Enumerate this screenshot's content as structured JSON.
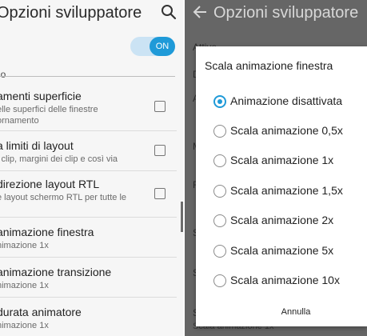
{
  "left": {
    "title": "Opzioni sviluppatore",
    "toggle_label": "ON",
    "section_header": "ho",
    "items": [
      {
        "title": "amenti superficie",
        "sub1": "elle superfici delle finestre",
        "sub2": "ornamento",
        "checkbox": true
      },
      {
        "title": "a limiti di layout",
        "sub1": "i clip, margini dei clip e così via",
        "sub2": "",
        "checkbox": true
      },
      {
        "title": "direzione layout RTL",
        "sub1": "e layout schermo RTL per tutte le",
        "sub2": "",
        "checkbox": true
      },
      {
        "title": "animazione finestra",
        "sub1": "nimazione 1x",
        "sub2": "",
        "checkbox": false
      },
      {
        "title": "animazione transizione",
        "sub1": "nimazione 1x",
        "sub2": "",
        "checkbox": false
      },
      {
        "title": "durata animatore",
        "sub1": "nimazione 1x",
        "sub2": "",
        "checkbox": false
      }
    ]
  },
  "right": {
    "title": "Opzioni sviluppatore",
    "bg": {
      "attivo": "Attivo",
      "d": "D",
      "a": "A",
      "m": "M",
      "r": "R",
      "s1": "S",
      "s2": "S",
      "s3": "S",
      "bottom_sub": "Scala animazione 1x"
    },
    "dialog": {
      "title": "Scala animazione finestra",
      "selected_index": 0,
      "options": [
        "Animazione disattivata",
        "Scala animazione 0,5x",
        "Scala animazione 1x",
        "Scala animazione 1,5x",
        "Scala animazione 2x",
        "Scala animazione 5x",
        "Scala animazione 10x"
      ],
      "cancel_label": "Annulla"
    }
  },
  "colors": {
    "accent": "#1f9ad8",
    "overlay": "#666666"
  }
}
